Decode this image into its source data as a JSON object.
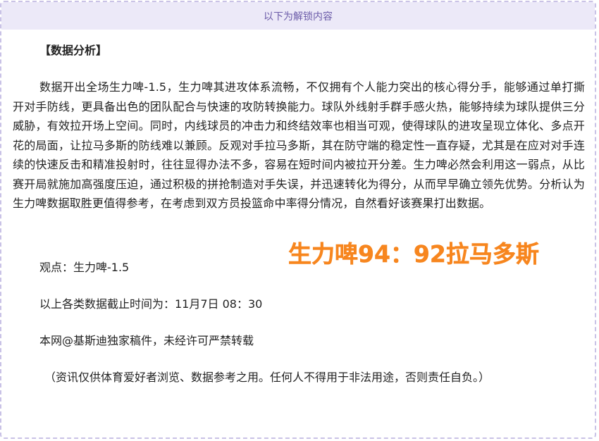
{
  "unlock_bar": {
    "label": "以下为解锁内容"
  },
  "article": {
    "section_title": "【数据分析】",
    "analysis_paragraph": "数据开出全场生力啤-1.5，生力啤其进攻体系流畅，不仅拥有个人能力突出的核心得分手，能够通过单打撕开对手防线，更具备出色的团队配合与快速的攻防转换能力。球队外线射手群手感火热，能够持续为球队提供三分威胁，有效拉开场上空间。同时，内线球员的冲击力和终结效率也相当可观，使得球队的进攻呈现立体化、多点开花的局面，让拉马多斯的防线难以兼顾。反观对手拉马多斯，其在防守端的稳定性一直存疑，尤其是在应对对手连续的快速反击和精准投射时，往往显得办法不多，容易在短时间内被拉开分差。生力啤必然会利用这一弱点，从比赛开局就施加高强度压迫，通过积极的拼抢制造对手失误，并迅速转化为得分，从而早早确立领先优势。分析认为生力啤数据取胜更值得参考，在考虑到双方员投篮命中率得分情况，自然看好该赛果打出数据。",
    "viewpoint": "观点：生力啤-1.5",
    "deadline": "以上各类数据截止时间为：11月7日 08：30",
    "copyright": "本网@基斯迪独家稿件，未经许可严禁转载",
    "disclaimer": "（资讯仅供体育爱好者浏览、数据参考之用。任何人不得用于非法用途，否则责任自负。）"
  },
  "score_overlay": {
    "text": "生力啤94：92拉马多斯",
    "color": "#f7861f"
  },
  "colors": {
    "unlock_bar_bg": "#ece9f8",
    "unlock_bar_text": "#6a5aa8",
    "frame_border": "#c9c2e6",
    "body_text": "#222222"
  }
}
